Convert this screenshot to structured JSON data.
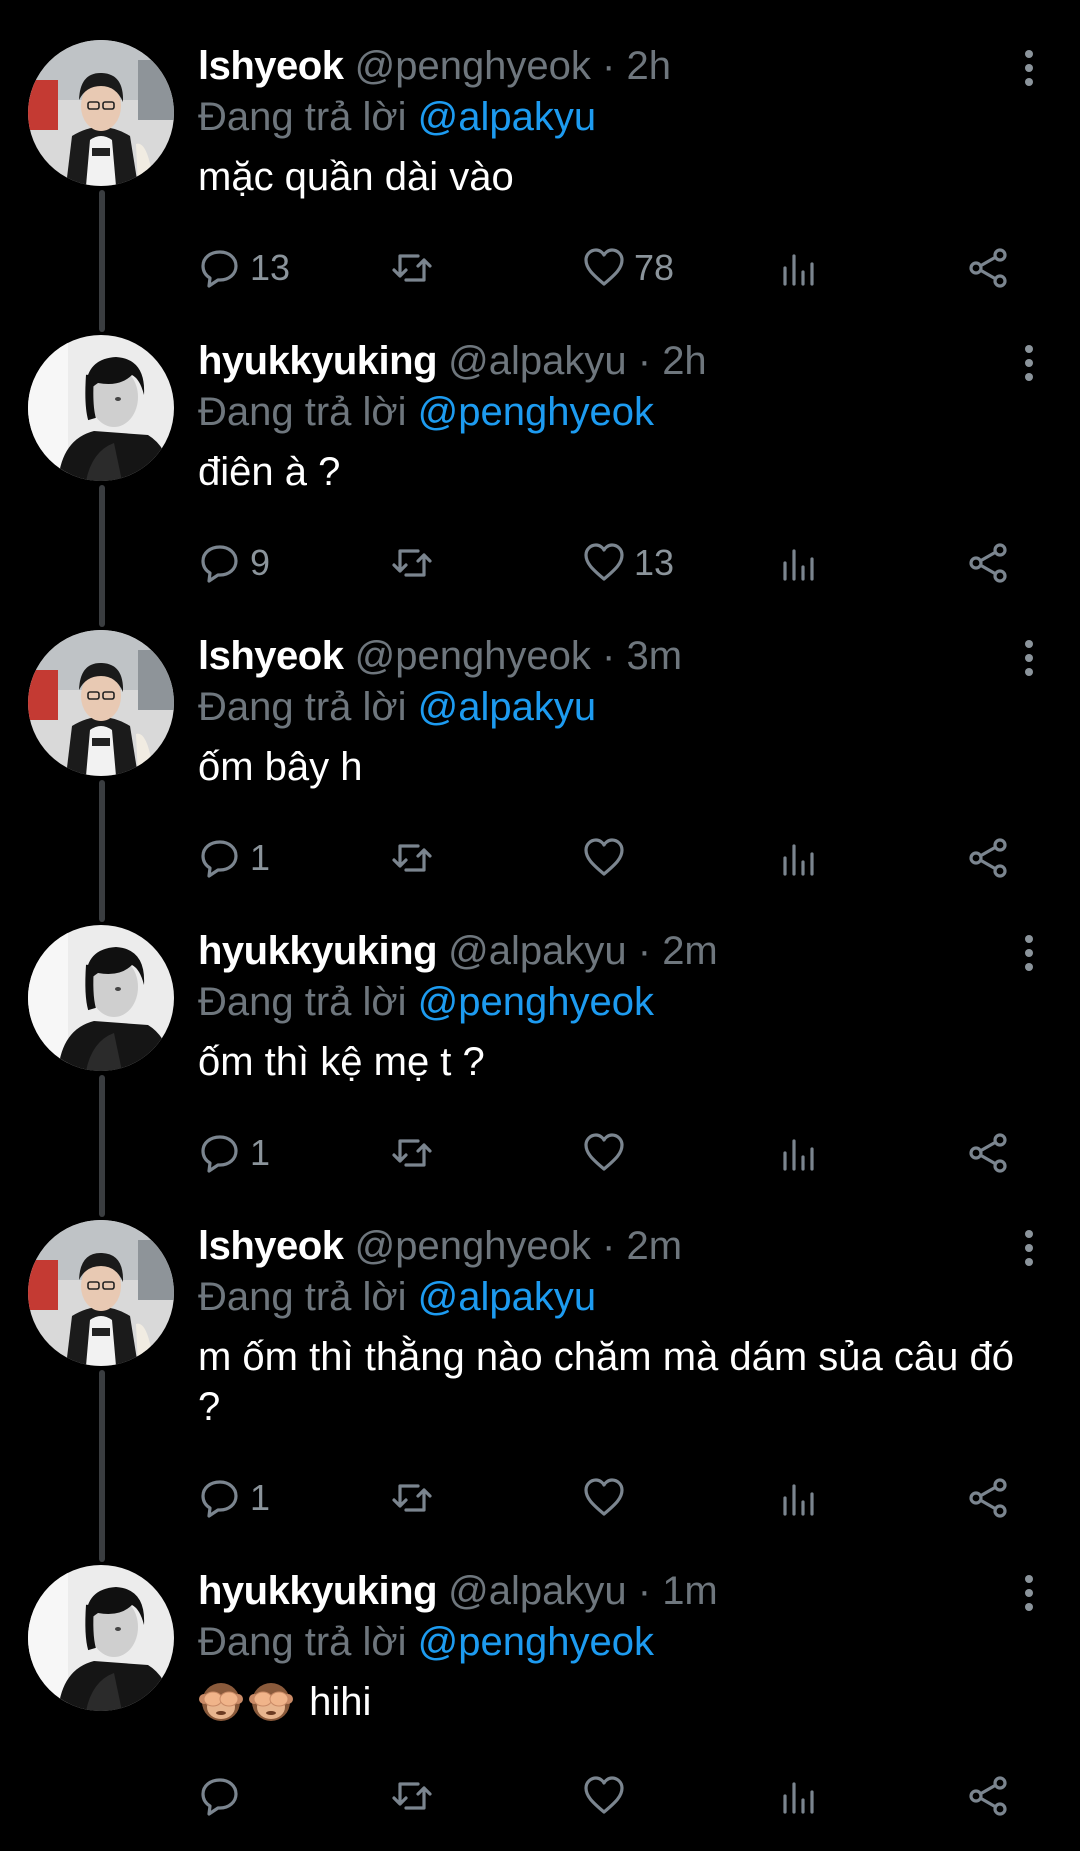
{
  "reply_prefix": "Đang trả lời",
  "tweets": [
    {
      "name": "lshyeok",
      "handle": "@penghyeok",
      "time": "2h",
      "reply_to": "@alpakyu",
      "text": "mặc quần dài vào",
      "replies": "13",
      "likes": "78",
      "avatar": "avatar-penghyeok"
    },
    {
      "name": "hyukkyuking",
      "handle": "@alpakyu",
      "time": "2h",
      "reply_to": "@penghyeok",
      "text": "điên à ?",
      "replies": "9",
      "likes": "13",
      "avatar": "avatar-alpakyu"
    },
    {
      "name": "lshyeok",
      "handle": "@penghyeok",
      "time": "3m",
      "reply_to": "@alpakyu",
      "text": "ốm bây h",
      "replies": "1",
      "likes": "",
      "avatar": "avatar-penghyeok"
    },
    {
      "name": "hyukkyuking",
      "handle": "@alpakyu",
      "time": "2m",
      "reply_to": "@penghyeok",
      "text": "ốm thì kệ mẹ t ?",
      "replies": "1",
      "likes": "",
      "avatar": "avatar-alpakyu"
    },
    {
      "name": "lshyeok",
      "handle": "@penghyeok",
      "time": "2m",
      "reply_to": "@alpakyu",
      "text": "m ốm thì thằng nào chăm mà dám sủa câu đó ?",
      "replies": "1",
      "likes": "",
      "avatar": "avatar-penghyeok"
    },
    {
      "name": "hyukkyuking",
      "handle": "@alpakyu",
      "time": "1m",
      "reply_to": "@penghyeok",
      "text": "hihi",
      "replies": "",
      "likes": "",
      "avatar": "avatar-alpakyu",
      "emoji": "see-no-evil-monkey x2"
    }
  ],
  "icons": {
    "reply": "reply-icon",
    "retweet": "retweet-icon",
    "like": "heart-icon",
    "views": "views-icon",
    "share": "share-icon",
    "more": "more-icon"
  },
  "colors": {
    "background": "#000000",
    "mention": "#1d9bf0",
    "muted": "#6e767d",
    "thread_line": "#3a3d40"
  }
}
